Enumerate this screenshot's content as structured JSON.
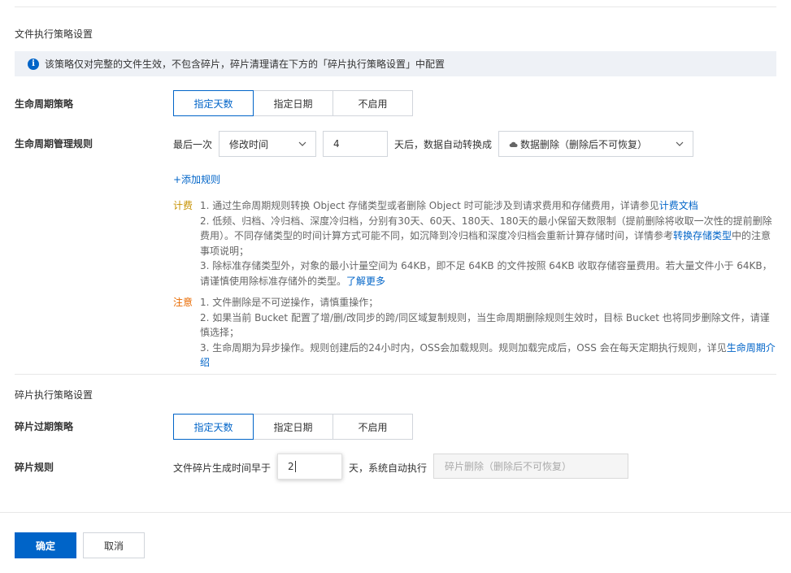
{
  "file_policy": {
    "section_title": "文件执行策略设置",
    "info": {
      "icon": "info-icon",
      "text": "该策略仅对完整的文件生效，不包含碎片，碎片清理请在下方的「碎片执行策略设置」中配置"
    },
    "lifecycle_strategy": {
      "label": "生命周期策略",
      "options": [
        "指定天数",
        "指定日期",
        "不启用"
      ],
      "selected": "指定天数"
    },
    "lifecycle_rule": {
      "label": "生命周期管理规则",
      "prefix": "最后一次",
      "time_field": "修改时间",
      "days_value": "4",
      "middle_text": "天后，数据自动转换成",
      "action_icon": "cloud-icon",
      "action": "数据删除（删除后不可恢复）"
    },
    "add_rule": "+添加规则",
    "notes": {
      "fee_tag": "计费",
      "fee_items": {
        "item1_text": "1. 通过生命周期规则转换 Object 存储类型或者删除 Object 时可能涉及到请求费用和存储费用，详请参见",
        "item1_link": "计费文档",
        "item2_text": "2. 低频、归档、冷归档、深度冷归档，分别有30天、60天、180天、180天的最小保留天数限制（提前删除将收取一次性的提前删除费用）。不同存储类型的时间计算方式可能不同，如沉降到冷归档和深度冷归档会重新计算存储时间，详情参考",
        "item2_link": "转换存储类型",
        "item2_suffix": "中的注意事项说明；",
        "item3_text": "3. 除标准存储类型外，对象的最小计量空间为 64KB，即不足 64KB 的文件按照 64KB 收取存储容量费用。若大量文件小于 64KB，请谨慎使用除标准存储外的类型。",
        "item3_link": "了解更多"
      },
      "warn_tag": "注意",
      "warn_items": {
        "item1_text": "1. 文件删除是不可逆操作，请慎重操作；",
        "item2_text": "2. 如果当前 Bucket 配置了增/删/改同步的跨/同区域复制规则，当生命周期删除规则生效时，目标 Bucket 也将同步删除文件，请谨慎选择；",
        "item3_text": "3. 生命周期为异步操作。规则创建后的24小时内，OSS会加载规则。规则加载完成后，OSS 会在每天定期执行规则，详见",
        "item3_link": "生命周期介绍"
      }
    }
  },
  "fragment_policy": {
    "section_title": "碎片执行策略设置",
    "expire_strategy": {
      "label": "碎片过期策略",
      "options": [
        "指定天数",
        "指定日期",
        "不启用"
      ],
      "selected": "指定天数"
    },
    "rule": {
      "label": "碎片规则",
      "prefix": "文件碎片生成时间早于",
      "days_value": "2",
      "middle_text": "天，系统自动执行",
      "action": "碎片删除（删除后不可恢复）"
    }
  },
  "footer": {
    "confirm_label": "确定",
    "cancel_label": "取消"
  },
  "colors": {
    "accent": "#0064c8",
    "fee_tag": "#c69100",
    "warn_tag": "#e86a00",
    "info_bg": "#eef1f6"
  }
}
